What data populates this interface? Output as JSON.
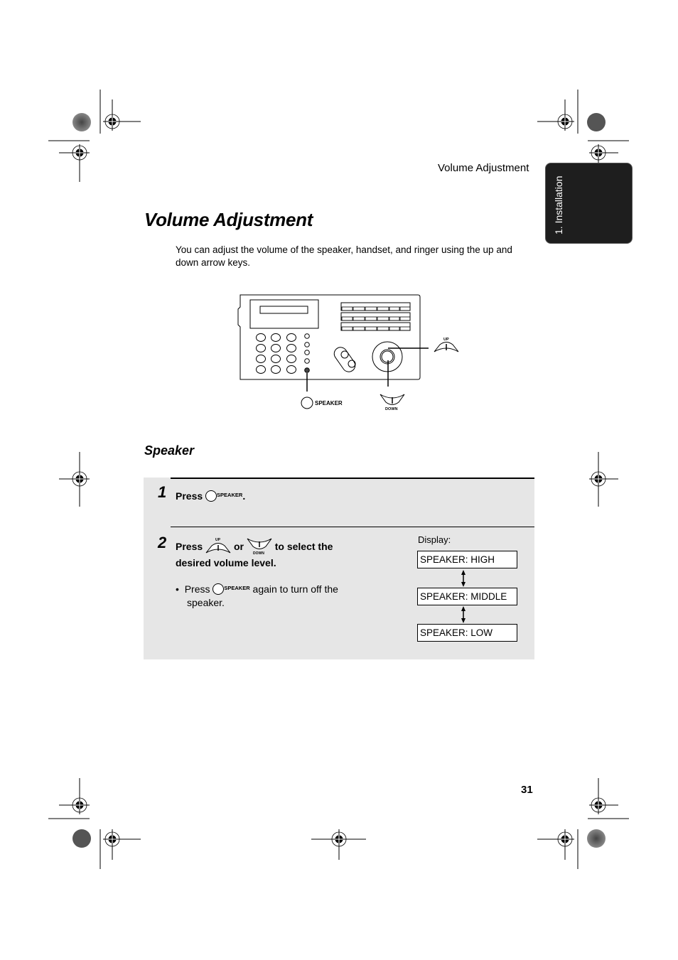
{
  "header": {
    "running_title": "Volume Adjustment",
    "side_tab": "1. Installation"
  },
  "page_title": "Volume Adjustment",
  "intro": "You can adjust the volume of the speaker, handset, and ringer using the up and down arrow keys.",
  "diagram": {
    "speaker_label": "SPEAKER",
    "up_label": "UP",
    "down_label": "DOWN"
  },
  "section_title": "Speaker",
  "steps": [
    {
      "number": "1",
      "press": "Press",
      "key": "SPEAKER",
      "suffix": "."
    },
    {
      "number": "2",
      "press": "Press",
      "up_key": "UP",
      "or": "or",
      "down_key": "DOWN",
      "text_after": "to select the",
      "text_line2": "desired volume level.",
      "bullet": {
        "press": "Press",
        "key": "SPEAKER",
        "text_after": "again to turn off the",
        "text_line2": "speaker."
      }
    }
  ],
  "display": {
    "label": "Display:",
    "states": [
      "SPEAKER: HIGH",
      "SPEAKER: MIDDLE",
      "SPEAKER: LOW"
    ]
  },
  "page_number": "31"
}
